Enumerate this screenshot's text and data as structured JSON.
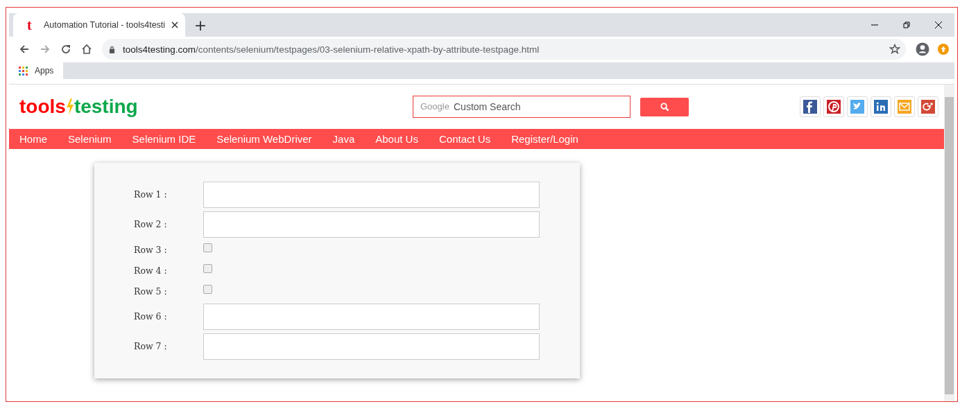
{
  "browser": {
    "tab": {
      "title": "Automation Tutorial - tools4testi",
      "favicon": "t",
      "selected": true
    },
    "new_tab": "+",
    "url": {
      "domain": "tools4testing.com",
      "path": "/contents/selenium/testpages/03-selenium-relative-xpath-by-attribute-testpage.html"
    },
    "bookmarks": [
      {
        "label": "Apps"
      }
    ]
  },
  "site": {
    "logo": {
      "left": "tools",
      "right": "testing"
    },
    "search": {
      "brand": "Google",
      "placeholder": "Custom Search"
    },
    "social": [
      {
        "kind": "facebook",
        "color": "#3b5998"
      },
      {
        "kind": "pinterest",
        "color": "#cb2027"
      },
      {
        "kind": "twitter",
        "color": "#55acee"
      },
      {
        "kind": "linkedin",
        "color": "#2a6db5"
      },
      {
        "kind": "email",
        "color": "#f5a623"
      },
      {
        "kind": "googleplus",
        "color": "#d34836"
      }
    ],
    "nav": [
      "Home",
      "Selenium",
      "Selenium IDE",
      "Selenium WebDriver",
      "Java",
      "About Us",
      "Contact Us",
      "Register/Login"
    ]
  },
  "form": {
    "rows": [
      {
        "label": "Row 1 :",
        "kind": "text"
      },
      {
        "label": "Row 2 :",
        "kind": "text"
      },
      {
        "label": "Row 3 :",
        "kind": "checkbox",
        "checked": false
      },
      {
        "label": "Row 4 :",
        "kind": "checkbox",
        "checked": false
      },
      {
        "label": "Row 5 :",
        "kind": "checkbox",
        "checked": false
      },
      {
        "label": "Row 6 :",
        "kind": "text"
      },
      {
        "label": "Row 7 :",
        "kind": "text"
      }
    ]
  }
}
